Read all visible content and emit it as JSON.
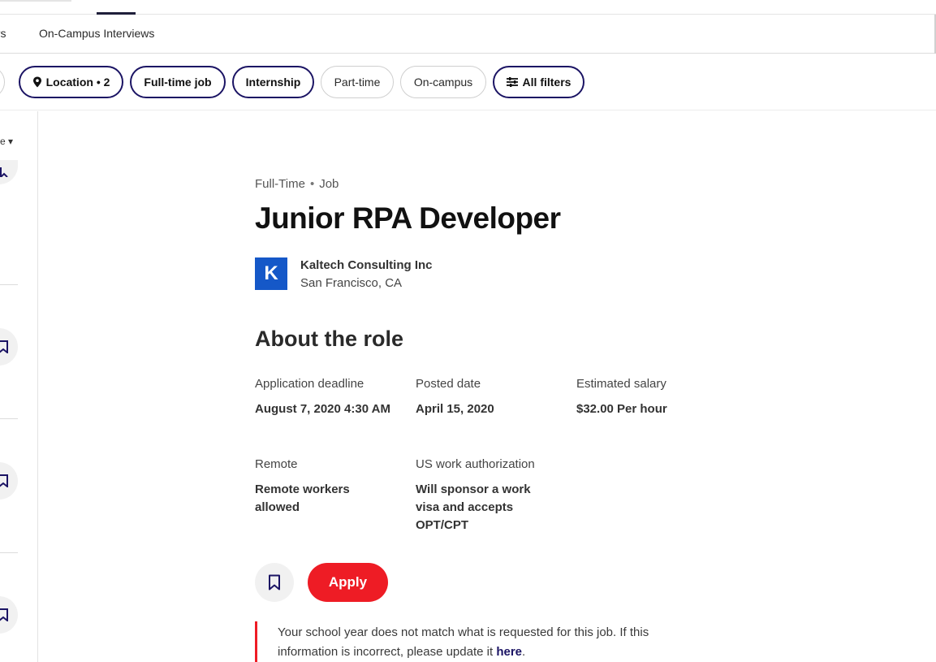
{
  "nav": {
    "partial_item": "ers",
    "item": "On-Campus Interviews"
  },
  "filters": [
    {
      "label": "Location • 2",
      "active": true,
      "icon": "location-pin-icon"
    },
    {
      "label": "Full-time job",
      "active": true
    },
    {
      "label": "Internship",
      "active": true
    },
    {
      "label": "Part-time",
      "active": false
    },
    {
      "label": "On-campus",
      "active": false
    },
    {
      "label": "All filters",
      "active": true,
      "icon": "sliders-icon"
    }
  ],
  "job": {
    "type": "Full-Time",
    "category": "Job",
    "title": "Junior RPA Developer",
    "company": {
      "logo_letter": "K",
      "name": "Kaltech Consulting Inc",
      "location": "San Francisco, CA"
    },
    "section_title": "About the role",
    "fields": {
      "deadline": {
        "label": "Application deadline",
        "value": "August 7, 2020 4:30 AM"
      },
      "posted": {
        "label": "Posted date",
        "value": "April 15, 2020"
      },
      "salary": {
        "label": "Estimated salary",
        "value": "$32.00 Per hour"
      },
      "remote": {
        "label": "Remote",
        "value": "Remote workers allowed"
      },
      "authorization": {
        "label": "US work authorization",
        "value": "Will sponsor a work visa and accepts OPT/CPT"
      }
    },
    "apply_label": "Apply",
    "notice": {
      "text": "Your school year does not match what is requested for this job. If this information is incorrect, please update it ",
      "link": "here",
      "end": "."
    }
  },
  "colors": {
    "accent": "#1b1464",
    "apply": "#ee1c25",
    "logo": "#1558c8"
  }
}
